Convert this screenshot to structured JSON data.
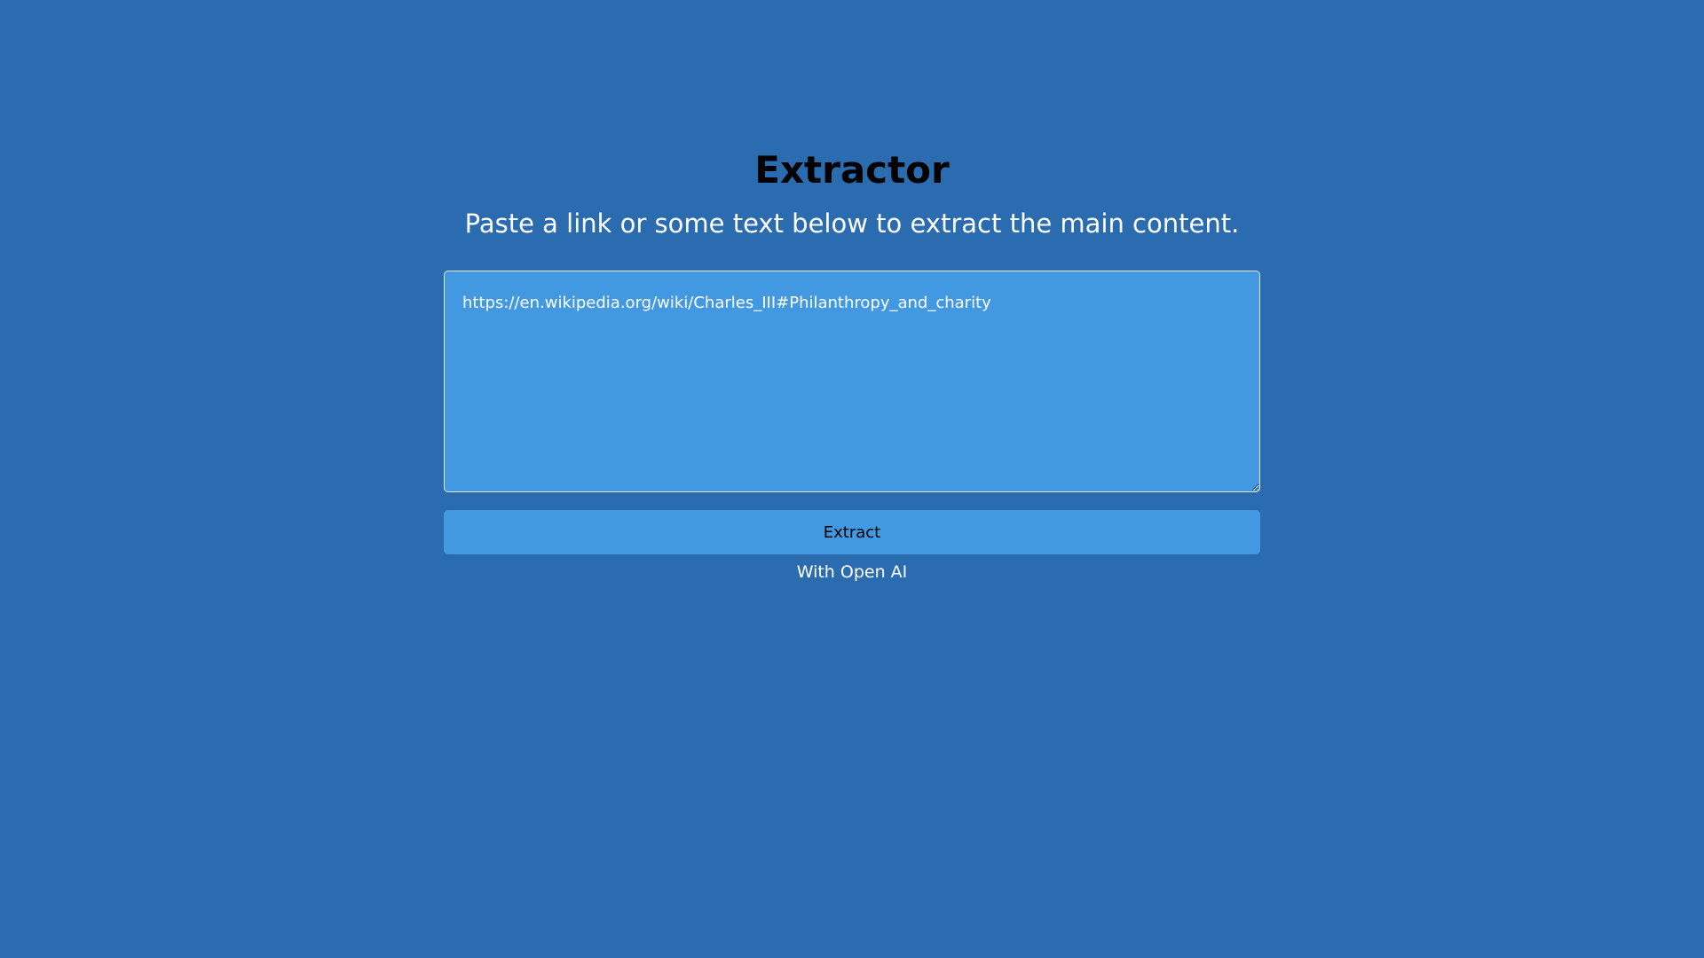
{
  "page": {
    "title": "Extractor",
    "subtitle": "Paste a link or some text below to extract the main content."
  },
  "input": {
    "value": "https://en.wikipedia.org/wiki/Charles_III#Philanthropy_and_charity"
  },
  "actions": {
    "extract_label": "Extract",
    "powered_by": "With Open AI"
  },
  "colors": {
    "background": "#2b6cb0",
    "panel": "#4299e1",
    "title": "#000000",
    "text": "#ffffff"
  }
}
